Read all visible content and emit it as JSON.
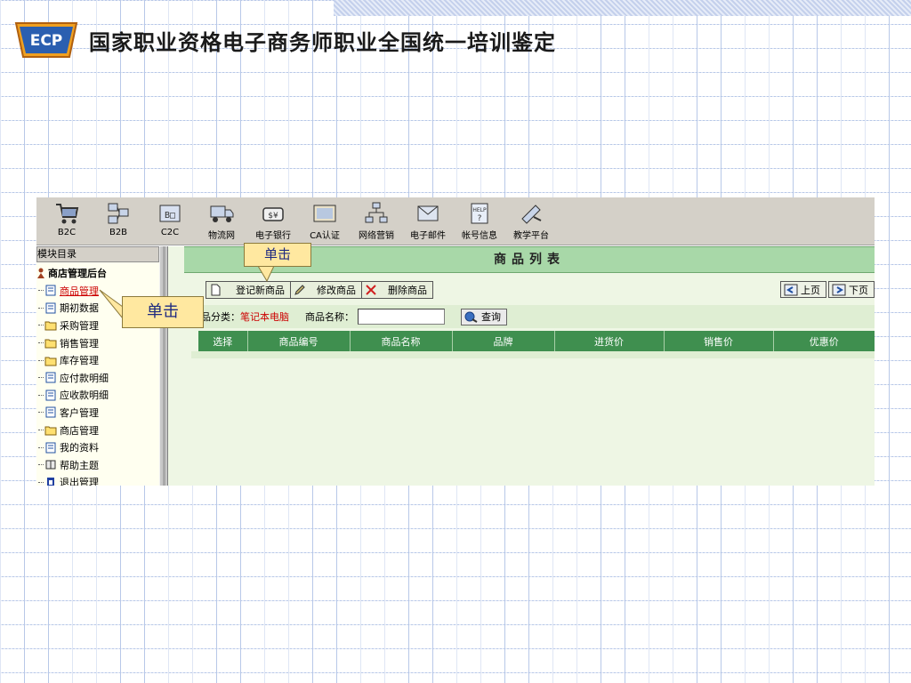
{
  "slide": {
    "title": "国家职业资格电子商务师职业全国统一培训鉴定",
    "logo_text": "ECP"
  },
  "toolbar": {
    "items": [
      {
        "label": "B2C",
        "icon": "shopping-cart-icon"
      },
      {
        "label": "B2B",
        "icon": "network-icon"
      },
      {
        "label": "C2C",
        "icon": "consumer-icon"
      },
      {
        "label": "物流网",
        "icon": "truck-icon"
      },
      {
        "label": "电子银行",
        "icon": "bank-icon"
      },
      {
        "label": "CA认证",
        "icon": "certificate-icon"
      },
      {
        "label": "网络营销",
        "icon": "marketing-icon"
      },
      {
        "label": "电子邮件",
        "icon": "email-icon"
      },
      {
        "label": "帐号信息",
        "icon": "help-icon"
      },
      {
        "label": "教学平台",
        "icon": "teaching-icon"
      }
    ]
  },
  "sidebar": {
    "header": "模块目录",
    "root": "商店管理后台",
    "items": [
      {
        "label": "商品管理",
        "type": "doc",
        "active": true
      },
      {
        "label": "期初数据",
        "type": "doc"
      },
      {
        "label": "采购管理",
        "type": "folder"
      },
      {
        "label": "销售管理",
        "type": "folder"
      },
      {
        "label": "库存管理",
        "type": "folder"
      },
      {
        "label": "应付款明细",
        "type": "doc"
      },
      {
        "label": "应收款明细",
        "type": "doc"
      },
      {
        "label": "客户管理",
        "type": "doc"
      },
      {
        "label": "商店管理",
        "type": "folder"
      },
      {
        "label": "我的资料",
        "type": "doc"
      },
      {
        "label": "帮助主题",
        "type": "book"
      },
      {
        "label": "退出管理",
        "type": "exit"
      }
    ]
  },
  "main": {
    "title": "商品列表",
    "actions": {
      "add": "登记新商品",
      "edit": "修改商品",
      "delete": "删除商品"
    },
    "pager": {
      "prev": "上页",
      "next": "下页"
    },
    "filter": {
      "category_label": "商品分类：",
      "category_value": "笔记本电脑",
      "name_label": "商品名称：",
      "name_value": "",
      "query_button": "查询"
    },
    "table": {
      "columns": [
        "选择",
        "商品编号",
        "商品名称",
        "品牌",
        "进货价",
        "销售价",
        "优惠价"
      ]
    }
  },
  "callouts": {
    "first": "单击",
    "second": "单击"
  },
  "colors": {
    "title_bar": "#a8d8a8",
    "table_header": "#3f8f4f",
    "active_item": "#cc0000",
    "callout_bg": "#ffe8a0"
  }
}
